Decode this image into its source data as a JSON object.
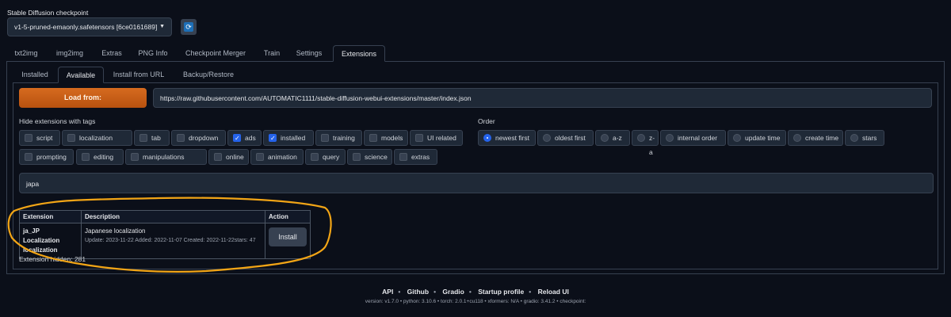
{
  "checkpoint": {
    "label": "Stable Diffusion checkpoint",
    "value": "v1-5-pruned-emaonly.safetensors [6ce0161689]"
  },
  "main_tabs": [
    {
      "label": "txt2img"
    },
    {
      "label": "img2img"
    },
    {
      "label": "Extras"
    },
    {
      "label": "PNG Info"
    },
    {
      "label": "Checkpoint Merger"
    },
    {
      "label": "Train"
    },
    {
      "label": "Settings"
    },
    {
      "label": "Extensions",
      "active": true
    }
  ],
  "sub_tabs": [
    {
      "label": "Installed"
    },
    {
      "label": "Available",
      "active": true
    },
    {
      "label": "Install from URL"
    },
    {
      "label": "Backup/Restore"
    }
  ],
  "load": {
    "button_label": "Load from:",
    "url": "https://raw.githubusercontent.com/AUTOMATIC1111/stable-diffusion-webui-extensions/master/index.json"
  },
  "hide_tags": {
    "label": "Hide extensions with tags",
    "items": [
      {
        "label": "script",
        "checked": false
      },
      {
        "label": "localization",
        "checked": false
      },
      {
        "label": "tab",
        "checked": false
      },
      {
        "label": "dropdown",
        "checked": false
      },
      {
        "label": "ads",
        "checked": true
      },
      {
        "label": "installed",
        "checked": true
      },
      {
        "label": "training",
        "checked": false
      },
      {
        "label": "models",
        "checked": false
      },
      {
        "label": "UI related",
        "checked": false
      },
      {
        "label": "prompting",
        "checked": false
      },
      {
        "label": "editing",
        "checked": false
      },
      {
        "label": "manipulations",
        "checked": false
      },
      {
        "label": "online",
        "checked": false
      },
      {
        "label": "animation",
        "checked": false
      },
      {
        "label": "query",
        "checked": false
      },
      {
        "label": "science",
        "checked": false
      },
      {
        "label": "extras",
        "checked": false
      }
    ]
  },
  "order": {
    "label": "Order",
    "items": [
      {
        "label": "newest first",
        "selected": true
      },
      {
        "label": "oldest first"
      },
      {
        "label": "a-z"
      },
      {
        "label": "z-a"
      },
      {
        "label": "internal order"
      },
      {
        "label": "update time"
      },
      {
        "label": "create time"
      },
      {
        "label": "stars"
      }
    ]
  },
  "search": {
    "value": "japa"
  },
  "table": {
    "headers": [
      "Extension",
      "Description",
      "Action"
    ],
    "rows": [
      {
        "name": "ja_JP Localization",
        "tag": "localization",
        "description": "Japanese localization",
        "meta": "Update: 2023-11-22 Added: 2022-11-07 Created: 2022-11-22stars: 47",
        "action": "Install"
      }
    ]
  },
  "hidden_count_text": "Extension hidden: 281",
  "footer": {
    "links": [
      "API",
      "Github",
      "Gradio",
      "Startup profile",
      "Reload UI"
    ],
    "version_line": "version: v1.7.0  •  python: 3.10.6  •  torch: 2.0.1+cu118  •  xformers: N/A  •  gradio: 3.41.2  •  checkpoint:"
  },
  "colors": {
    "background": "#0b0f19",
    "accent_orange": "#d66b1f",
    "checkbox_blue": "#2563eb",
    "annotation": "#f2a516"
  }
}
